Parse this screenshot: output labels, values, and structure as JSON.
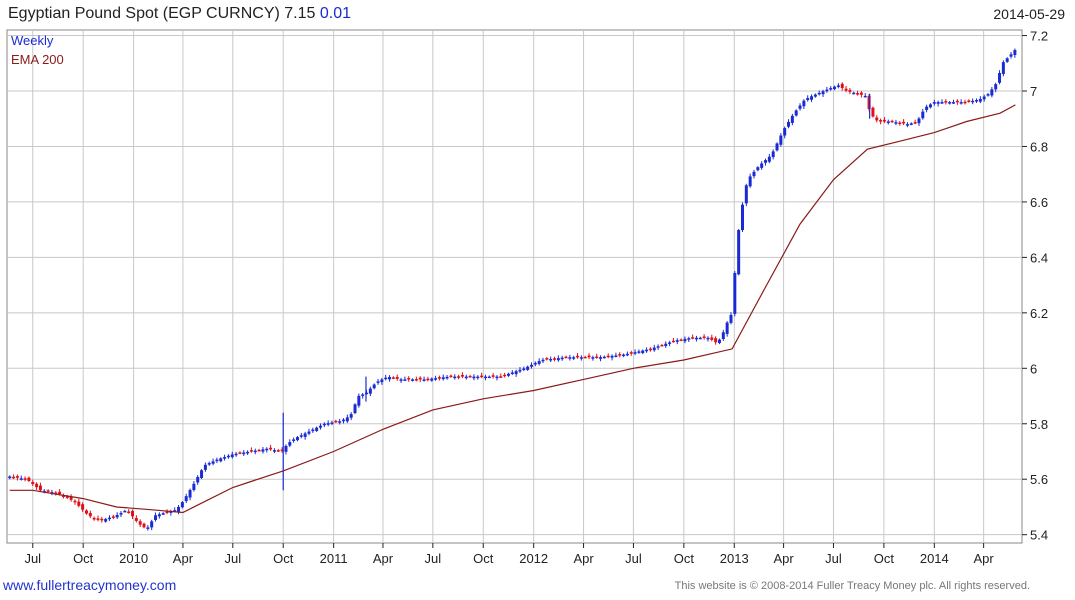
{
  "header": {
    "title": "Egyptian Pound Spot (EGP CURNCY) 7.15",
    "change": "0.01",
    "date": "2014-05-29"
  },
  "footer": {
    "site_link": "www.fullertreacymoney.com",
    "copyright": "This website is © 2008-2014 Fuller Treacy Money plc. All rights reserved."
  },
  "colors": {
    "up": "#1a2bd6",
    "down": "#e0101a",
    "ema": "#8b1a1a",
    "grid": "#c8c8c8",
    "axis": "#222222"
  },
  "chart_data": {
    "type": "candlestick",
    "legend": [
      {
        "label": "Weekly",
        "color": "#1a2bd6"
      },
      {
        "label": "EMA 200",
        "color": "#8b1a1a"
      }
    ],
    "legend_position": "top-left",
    "grid": true,
    "ylim": [
      5.37,
      7.22
    ],
    "y_ticks": [
      5.4,
      5.6,
      5.8,
      6.0,
      6.2,
      6.4,
      6.6,
      6.8,
      7.0,
      7.2
    ],
    "y_tick_labels": [
      "5.4",
      "5.6",
      "5.8",
      "6",
      "6.2",
      "6.4",
      "6.6",
      "6.8",
      "7",
      "7.2"
    ],
    "xlim": [
      "2009-05-15",
      "2014-06-10"
    ],
    "x_ticks": [
      {
        "date": "2009-07-01",
        "label": "Jul"
      },
      {
        "date": "2009-10-01",
        "label": "Oct"
      },
      {
        "date": "2010-01-01",
        "label": "2010"
      },
      {
        "date": "2010-04-01",
        "label": "Apr"
      },
      {
        "date": "2010-07-01",
        "label": "Jul"
      },
      {
        "date": "2010-10-01",
        "label": "Oct"
      },
      {
        "date": "2011-01-01",
        "label": "2011"
      },
      {
        "date": "2011-04-01",
        "label": "Apr"
      },
      {
        "date": "2011-07-01",
        "label": "Jul"
      },
      {
        "date": "2011-10-01",
        "label": "Oct"
      },
      {
        "date": "2012-01-01",
        "label": "2012"
      },
      {
        "date": "2012-04-01",
        "label": "Apr"
      },
      {
        "date": "2012-07-01",
        "label": "Jul"
      },
      {
        "date": "2012-10-01",
        "label": "Oct"
      },
      {
        "date": "2013-01-01",
        "label": "2013"
      },
      {
        "date": "2013-04-01",
        "label": "Apr"
      },
      {
        "date": "2013-07-01",
        "label": "Jul"
      },
      {
        "date": "2013-10-01",
        "label": "Oct"
      },
      {
        "date": "2014-01-01",
        "label": "2014"
      },
      {
        "date": "2014-04-01",
        "label": "Apr"
      }
    ],
    "price_close": [
      [
        "2009-05-20",
        5.61
      ],
      [
        "2009-06-20",
        5.6
      ],
      [
        "2009-07-15",
        5.56
      ],
      [
        "2009-08-15",
        5.55
      ],
      [
        "2009-09-15",
        5.52
      ],
      [
        "2009-10-10",
        5.47
      ],
      [
        "2009-11-01",
        5.45
      ],
      [
        "2009-12-01",
        5.47
      ],
      [
        "2009-12-20",
        5.49
      ],
      [
        "2010-01-10",
        5.44
      ],
      [
        "2010-01-25",
        5.42
      ],
      [
        "2010-02-10",
        5.47
      ],
      [
        "2010-03-01",
        5.48
      ],
      [
        "2010-03-20",
        5.49
      ],
      [
        "2010-04-01",
        5.52
      ],
      [
        "2010-04-20",
        5.58
      ],
      [
        "2010-05-10",
        5.65
      ],
      [
        "2010-06-01",
        5.67
      ],
      [
        "2010-07-01",
        5.69
      ],
      [
        "2010-08-01",
        5.7
      ],
      [
        "2010-09-01",
        5.71
      ],
      [
        "2010-09-28",
        5.7
      ],
      [
        "2010-10-10",
        5.73
      ],
      [
        "2010-10-25",
        5.75
      ],
      [
        "2010-11-15",
        5.77
      ],
      [
        "2010-12-15",
        5.8
      ],
      [
        "2011-01-15",
        5.81
      ],
      [
        "2011-02-01",
        5.83
      ],
      [
        "2011-02-15",
        5.9
      ],
      [
        "2011-03-01",
        5.91
      ],
      [
        "2011-03-20",
        5.95
      ],
      [
        "2011-04-10",
        5.97
      ],
      [
        "2011-05-01",
        5.96
      ],
      [
        "2011-06-15",
        5.96
      ],
      [
        "2011-08-01",
        5.97
      ],
      [
        "2011-09-15",
        5.97
      ],
      [
        "2011-11-01",
        5.97
      ],
      [
        "2011-12-15",
        6.0
      ],
      [
        "2012-01-15",
        6.03
      ],
      [
        "2012-03-01",
        6.04
      ],
      [
        "2012-05-01",
        6.04
      ],
      [
        "2012-06-15",
        6.05
      ],
      [
        "2012-08-01",
        6.07
      ],
      [
        "2012-09-15",
        6.1
      ],
      [
        "2012-10-15",
        6.11
      ],
      [
        "2012-11-15",
        6.11
      ],
      [
        "2012-12-01",
        6.09
      ],
      [
        "2012-12-10",
        6.12
      ],
      [
        "2012-12-20",
        6.17
      ],
      [
        "2012-12-28",
        6.2
      ],
      [
        "2013-01-05",
        6.43
      ],
      [
        "2013-01-12",
        6.55
      ],
      [
        "2013-01-25",
        6.68
      ],
      [
        "2013-02-15",
        6.73
      ],
      [
        "2013-03-10",
        6.77
      ],
      [
        "2013-04-01",
        6.86
      ],
      [
        "2013-04-20",
        6.92
      ],
      [
        "2013-05-10",
        6.97
      ],
      [
        "2013-06-01",
        6.99
      ],
      [
        "2013-06-25",
        7.01
      ],
      [
        "2013-07-10",
        7.02
      ],
      [
        "2013-07-25",
        7.0
      ],
      [
        "2013-08-15",
        6.99
      ],
      [
        "2013-09-01",
        6.98
      ],
      [
        "2013-09-05",
        6.92
      ],
      [
        "2013-09-20",
        6.89
      ],
      [
        "2013-10-15",
        6.89
      ],
      [
        "2013-11-15",
        6.88
      ],
      [
        "2013-12-01",
        6.89
      ],
      [
        "2013-12-15",
        6.94
      ],
      [
        "2014-01-01",
        6.96
      ],
      [
        "2014-02-01",
        6.96
      ],
      [
        "2014-03-01",
        6.96
      ],
      [
        "2014-03-25",
        6.97
      ],
      [
        "2014-04-10",
        6.99
      ],
      [
        "2014-04-25",
        7.03
      ],
      [
        "2014-05-05",
        7.1
      ],
      [
        "2014-05-20",
        7.13
      ],
      [
        "2014-05-29",
        7.15
      ]
    ],
    "ema_200": [
      [
        "2009-05-20",
        5.56
      ],
      [
        "2009-07-01",
        5.56
      ],
      [
        "2009-10-01",
        5.53
      ],
      [
        "2009-12-01",
        5.5
      ],
      [
        "2010-02-01",
        5.49
      ],
      [
        "2010-04-01",
        5.48
      ],
      [
        "2010-05-01",
        5.51
      ],
      [
        "2010-07-01",
        5.57
      ],
      [
        "2010-10-01",
        5.63
      ],
      [
        "2011-01-01",
        5.7
      ],
      [
        "2011-04-01",
        5.78
      ],
      [
        "2011-07-01",
        5.85
      ],
      [
        "2011-10-01",
        5.89
      ],
      [
        "2012-01-01",
        5.92
      ],
      [
        "2012-04-01",
        5.96
      ],
      [
        "2012-07-01",
        6.0
      ],
      [
        "2012-10-01",
        6.03
      ],
      [
        "2012-12-28",
        6.07
      ],
      [
        "2013-03-01",
        6.3
      ],
      [
        "2013-05-01",
        6.52
      ],
      [
        "2013-07-01",
        6.68
      ],
      [
        "2013-09-01",
        6.79
      ],
      [
        "2013-11-01",
        6.82
      ],
      [
        "2014-01-01",
        6.85
      ],
      [
        "2014-03-01",
        6.89
      ],
      [
        "2014-05-01",
        6.92
      ],
      [
        "2014-05-29",
        6.95
      ]
    ],
    "notable_spikes": [
      {
        "date": "2010-10-01",
        "high": 5.84,
        "low": 5.56
      },
      {
        "date": "2011-03-01",
        "high": 5.97,
        "low": 5.88
      },
      {
        "date": "2013-09-05",
        "high": 6.99,
        "low": 6.9
      }
    ]
  }
}
